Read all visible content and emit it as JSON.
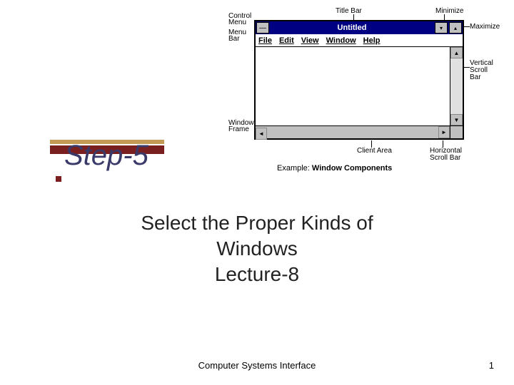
{
  "window_diagram": {
    "labels": {
      "title_bar": "Title Bar",
      "minimize": "Minimize",
      "control_menu_l1": "Control",
      "control_menu_l2": "Menu",
      "maximize": "Maximize",
      "menu_bar_l1": "Menu",
      "menu_bar_l2": "Bar",
      "vscroll_l1": "Vertical",
      "vscroll_l2": "Scroll",
      "vscroll_l3": "Bar",
      "winframe_l1": "Window",
      "winframe_l2": "Frame",
      "client_area_l1": "Client Area",
      "hscroll_l1": "Horizontal",
      "hscroll_l2": "Scroll Bar"
    },
    "window": {
      "title": "Untitled",
      "menus": {
        "file": "File",
        "edit": "Edit",
        "view": "View",
        "window": "Window",
        "help": "Help"
      }
    },
    "caption_prefix": "Example: ",
    "caption_bold": "Window Components"
  },
  "slide": {
    "step_title": "Step-5",
    "subtitle_l1": "Select the Proper Kinds of",
    "subtitle_l2": "Windows",
    "subtitle_l3": "Lecture-8",
    "footer_center": "Computer Systems Interface",
    "page_number": "1"
  }
}
